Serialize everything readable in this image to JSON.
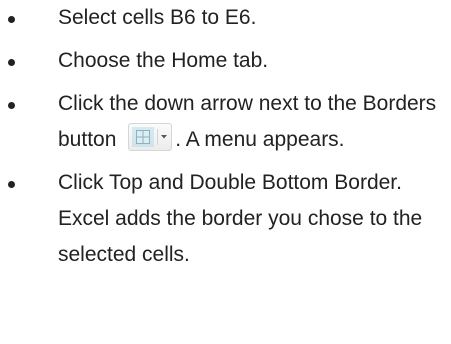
{
  "steps": [
    {
      "text": "Select cells B6 to E6."
    },
    {
      "text": "Choose the Home tab."
    },
    {
      "text_before": "Click the down arrow next to the Borders button",
      "text_after": ". A menu appears."
    },
    {
      "text": "Click Top and Double Bottom Border. Excel adds the border you chose to the selected cells."
    }
  ],
  "borders_button": {
    "icon": "borders-grid-icon",
    "dropdown_icon": "dropdown-arrow-icon"
  }
}
